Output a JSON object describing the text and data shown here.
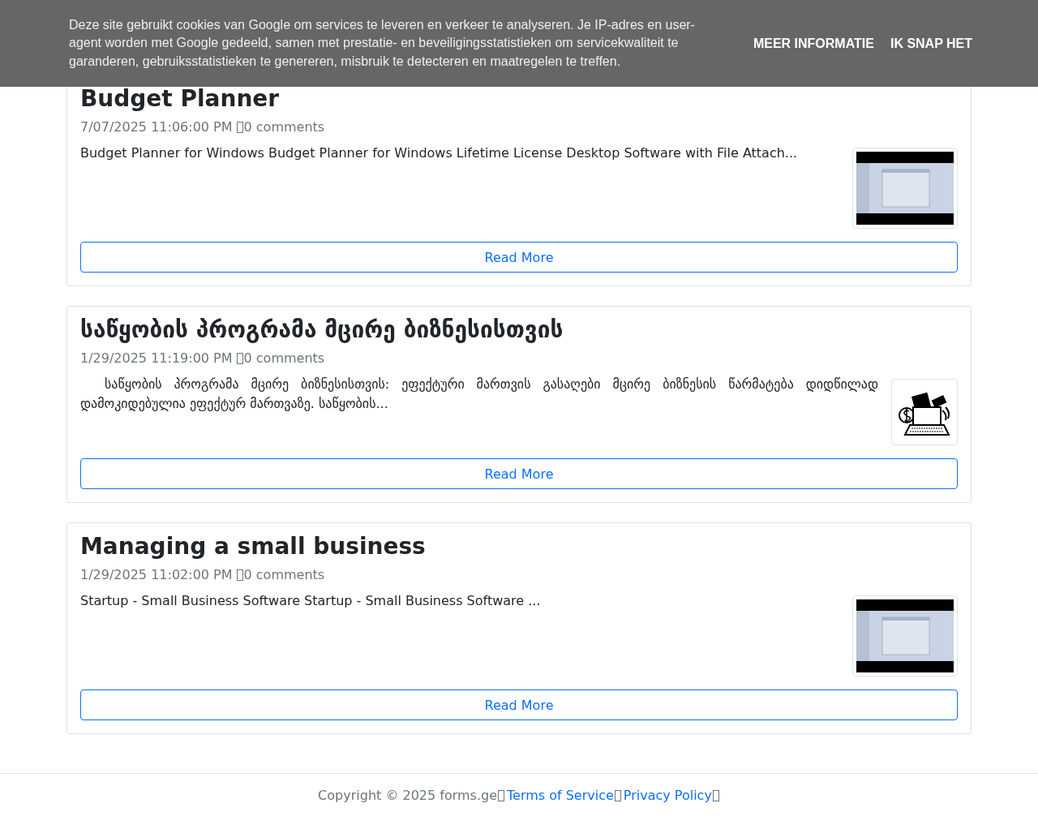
{
  "cookie_banner": {
    "text": "Deze site gebruikt cookies van Google om services te leveren en verkeer te analyseren. Je IP-adres en user-agent worden met Google gedeeld, samen met prestatie- en beveiligingsstatistieken om servicekwaliteit te garanderen, gebruiksstatistieken te genereren, misbruik te detecteren en maatregelen te treffen.",
    "buttons": [
      "MEER INFORMATIE",
      "IK SNAP HET"
    ]
  },
  "posts": [
    {
      "title": "Budget Planner",
      "date": "7/07/2025 11:06:00 PM",
      "comments": "0 comments",
      "excerpt": "Budget Planner for Windows Budget Planner for Windows Lifetime License Desktop Software with File Attach...",
      "thumbnail": {
        "kind": "screenshot"
      },
      "read_more": "Read More"
    },
    {
      "title": "საწყობის პროგრამა მცირე ბიზნესისთვის",
      "date": "1/29/2025 11:19:00 PM",
      "comments": "0 comments",
      "excerpt": "საწყობის პროგრამა მცირე ბიზნესისთვის: ეფექტური მართვის გასაღები მცირე ბიზნესის წარმატება დიდწილად დამოკიდებულია ეფექტურ მართვაზე. საწყობის...",
      "thumbnail": {
        "kind": "illustration"
      },
      "read_more": "Read More"
    },
    {
      "title": "Managing a small business",
      "date": "1/29/2025 11:02:00 PM",
      "comments": "0 comments",
      "excerpt": "Startup - Small Business Software Startup - Small Business Software ...",
      "thumbnail": {
        "kind": "screenshot"
      },
      "read_more": "Read More"
    }
  ],
  "footer": {
    "copyright": "Copyright © 2025 forms.ge",
    "links": [
      "Terms of Service",
      "Privacy Policy"
    ]
  }
}
